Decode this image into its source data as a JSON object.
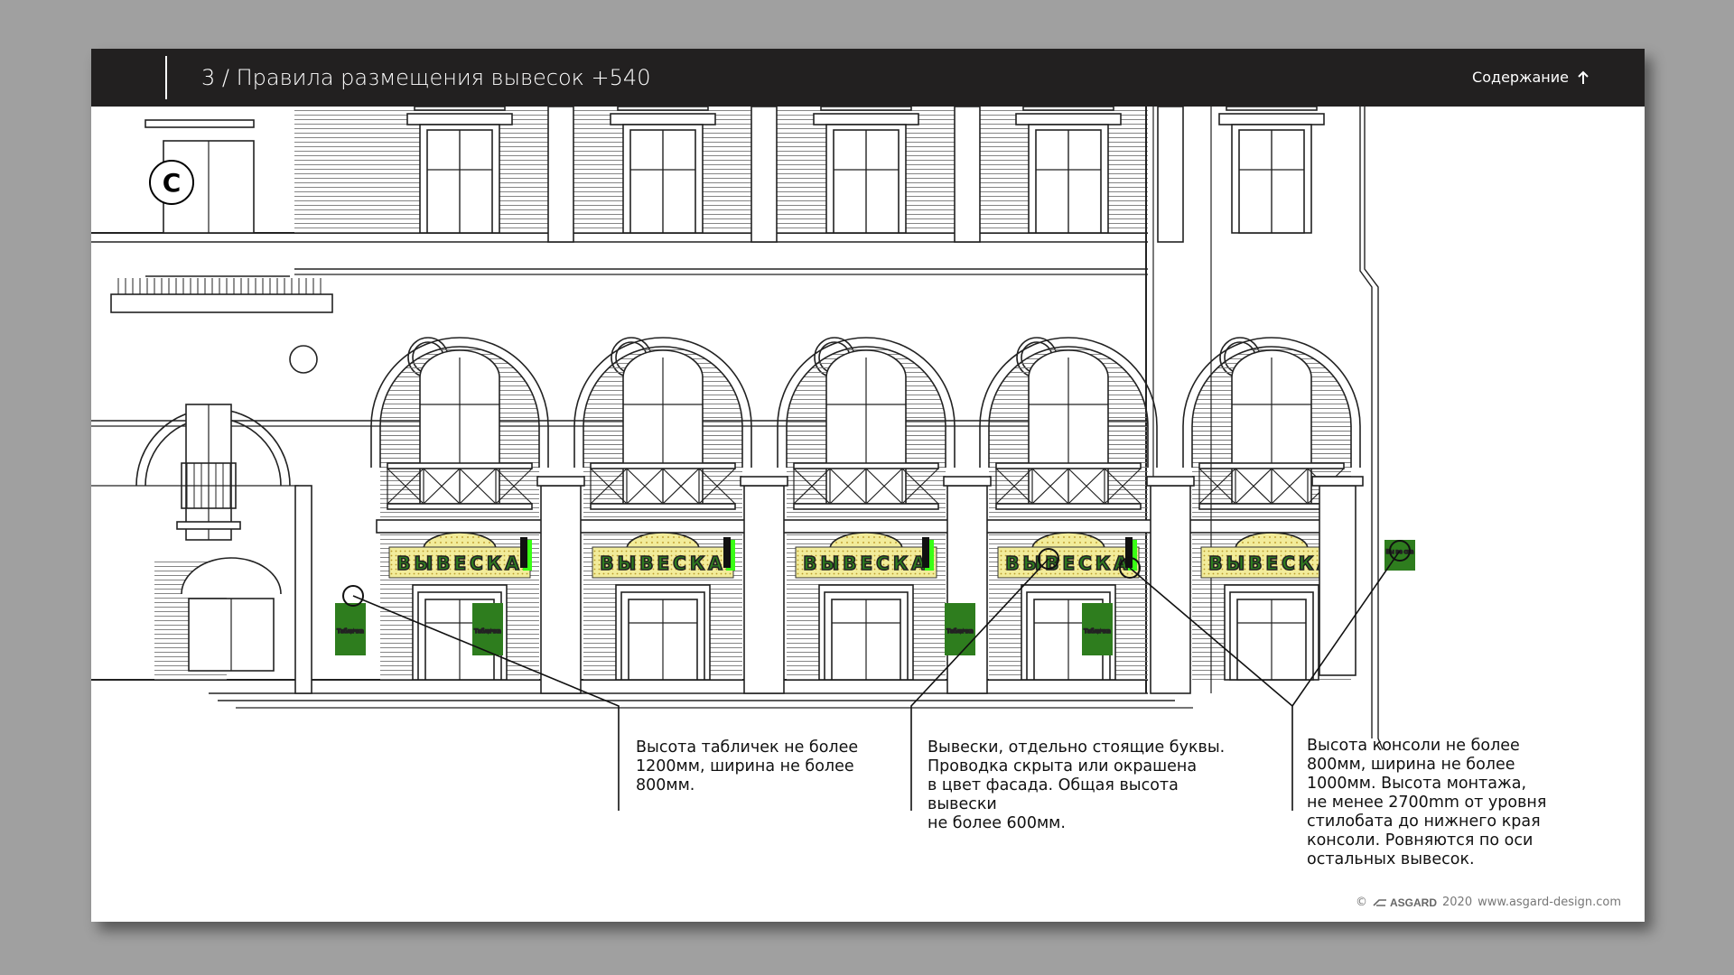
{
  "header": {
    "title": "3 / Правила размещения вывесок +540",
    "toc_label": "Содержание"
  },
  "section_badge": "С",
  "signs": {
    "fascia_label": "ВЫВЕСКА",
    "plate_label": "Табличка",
    "console_label": "Вы ве ска"
  },
  "callouts": [
    {
      "text": "Высота табличек не более\n1200мм, ширина не более\n800мм."
    },
    {
      "text": "Вывески, отдельно стоящие буквы.\nПроводка скрыта или окрашена\nв цвет фасада. Общая высота\nвывески\nне более 600мм."
    },
    {
      "text": "Высота консоли не более\n800мм, ширина не более\n1000мм. Высота монтажа,\nне менее 2700mm от уровня\nстилобата до нижнего края\nконсоли. Ровняются по оси\nостальных вывесок."
    }
  ],
  "footer": {
    "copyright": "©",
    "brand": "ASGARD",
    "year": "2020",
    "site": "www.asgard-design.com"
  },
  "colors": {
    "header_bg": "#222020",
    "sign_green": "#2e7d1e",
    "sign_yellow": "#f2ec9a",
    "accent_green": "#39ff14"
  }
}
